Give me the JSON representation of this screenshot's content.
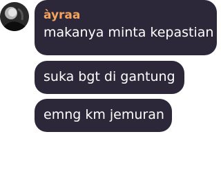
{
  "chat": {
    "sender_name": "àyraa",
    "avatar": {
      "icon": "user-avatar",
      "colors": [
        "#9a9a9a",
        "#141414"
      ]
    },
    "bubble_color": "#2c2839",
    "name_color": "#f5a35a",
    "messages": [
      {
        "text": "makanya minta kepastian"
      },
      {
        "text": "suka bgt di gantung"
      },
      {
        "text": "emng km jemuran"
      }
    ]
  }
}
